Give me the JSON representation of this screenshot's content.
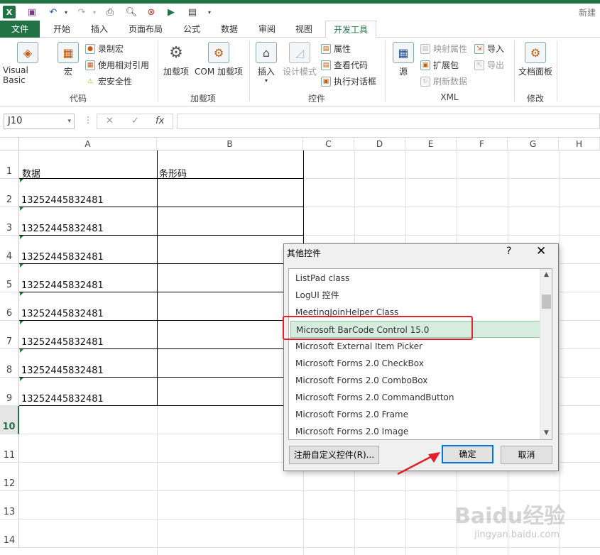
{
  "window": {
    "title": "新建"
  },
  "tabs": [
    "文件",
    "开始",
    "插入",
    "页面布局",
    "公式",
    "数据",
    "审阅",
    "视图",
    "开发工具"
  ],
  "ribbon": {
    "code": {
      "label": "代码",
      "visual_basic": "Visual Basic",
      "macros": "宏",
      "record_macro": "录制宏",
      "relative_ref": "使用相对引用",
      "macro_security": "宏安全性"
    },
    "addins": {
      "label": "加载项",
      "addins": "加载项",
      "com_addins": "COM 加载项"
    },
    "controls": {
      "label": "控件",
      "insert": "插入",
      "design_mode": "设计模式",
      "properties": "属性",
      "view_code": "查看代码",
      "run_dialog": "执行对话框"
    },
    "xml": {
      "label": "XML",
      "source": "源",
      "map_props": "映射属性",
      "expansion": "扩展包",
      "refresh": "刷新数据",
      "import": "导入",
      "export": "导出"
    },
    "modify": {
      "label": "修改",
      "doc_panel": "文档面板"
    }
  },
  "formula_bar": {
    "name_box": "J10",
    "fx": "fx",
    "cancel": "✕",
    "enter": "✓"
  },
  "sheet": {
    "columns": [
      "A",
      "B",
      "C",
      "D",
      "E",
      "F",
      "G",
      "H"
    ],
    "rows": [
      "1",
      "2",
      "3",
      "4",
      "5",
      "6",
      "7",
      "8",
      "9",
      "10",
      "11",
      "12",
      "13",
      "14"
    ],
    "header_a": "数据",
    "header_b": "条形码",
    "values": [
      "13252445832481",
      "13252445832481",
      "13252445832481",
      "13252445832481",
      "13252445832481",
      "13252445832481",
      "13252445832481",
      "13252445832481"
    ]
  },
  "dialog": {
    "title": "其他控件",
    "help": "?",
    "close": "✕",
    "items": [
      "ListPad class",
      "LogUI 控件",
      "MeetingJoinHelper Class",
      "Microsoft BarCode Control 15.0",
      "Microsoft External Item Picker",
      "Microsoft Forms 2.0 CheckBox",
      "Microsoft Forms 2.0 ComboBox",
      "Microsoft Forms 2.0 CommandButton",
      "Microsoft Forms 2.0 Frame",
      "Microsoft Forms 2.0 Image"
    ],
    "register_button": "注册自定义控件(R)...",
    "ok_button": "确定",
    "cancel_button": "取消"
  },
  "watermark": {
    "main": "Baidu经验",
    "sub": "jingyan.baidu.com"
  },
  "colors": {
    "accent": "#217346",
    "highlight": "#e0202a",
    "selection": "#d5ecdf"
  }
}
